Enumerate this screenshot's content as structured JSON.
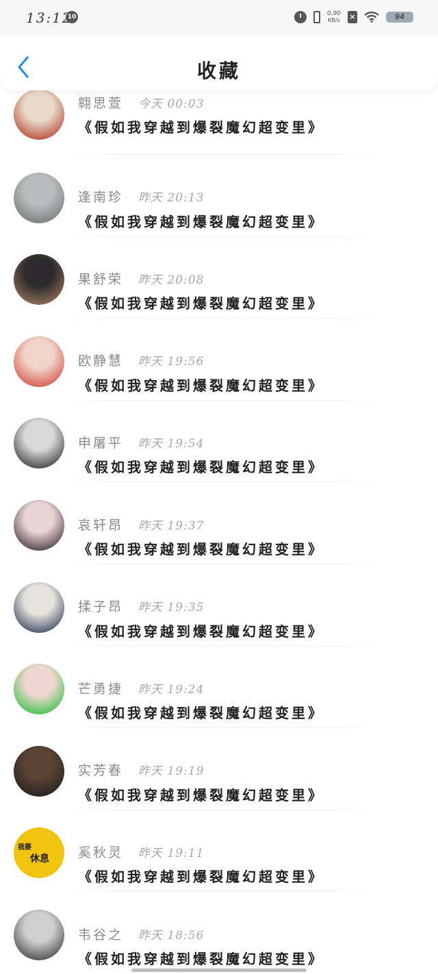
{
  "status_bar": {
    "time": "13:12",
    "notification_count": "10",
    "net_speed_value": "0.90",
    "net_speed_unit": "KB/s",
    "battery": "94"
  },
  "header": {
    "title": "收藏",
    "back_icon": "chevron-left-icon",
    "accent": "#2b8de6"
  },
  "favorites": [
    {
      "name": "翱思萱",
      "time": "今天 00:03",
      "title": "《假如我穿越到爆裂魔幻超变里》",
      "avatar_colors": [
        "#e8d9c8",
        "#b23b2a"
      ]
    },
    {
      "name": "逢南珍",
      "time": "昨天 20:13",
      "title": "《假如我穿越到爆裂魔幻超变里》",
      "avatar_colors": [
        "#b9bdbd",
        "#6f7676"
      ]
    },
    {
      "name": "果舒荣",
      "time": "昨天 20:08",
      "title": "《假如我穿越到爆裂魔幻超变里》",
      "avatar_colors": [
        "#2c2a2c",
        "#a27a5f"
      ]
    },
    {
      "name": "欧静慧",
      "time": "昨天 19:56",
      "title": "《假如我穿越到爆裂魔幻超变里》",
      "avatar_colors": [
        "#f2d3c9",
        "#d14a3b"
      ]
    },
    {
      "name": "申屠平",
      "time": "昨天 19:54",
      "title": "《假如我穿越到爆裂魔幻超变里》",
      "avatar_colors": [
        "#d8d8d8",
        "#2e2e2e"
      ]
    },
    {
      "name": "哀轩昂",
      "time": "昨天 19:37",
      "title": "《假如我穿越到爆裂魔幻超变里》",
      "avatar_colors": [
        "#e8d4d4",
        "#3a2b30"
      ]
    },
    {
      "name": "揉子昂",
      "time": "昨天 19:35",
      "title": "《假如我穿越到爆裂魔幻超变里》",
      "avatar_colors": [
        "#e6e2dc",
        "#2e3a55"
      ]
    },
    {
      "name": "芒勇捷",
      "time": "昨天 19:24",
      "title": "《假如我穿越到爆裂魔幻超变里》",
      "avatar_colors": [
        "#f0d6d0",
        "#29c23c"
      ]
    },
    {
      "name": "实芳春",
      "time": "昨天 19:19",
      "title": "《假如我穿越到爆裂魔幻超变里》",
      "avatar_colors": [
        "#5b4334",
        "#1e1e1e"
      ]
    },
    {
      "name": "奚秋灵",
      "time": "昨天 19:11",
      "title": "《假如我穿越到爆裂魔幻超变里》",
      "avatar_colors": [
        "#f1c40f",
        "#f1c40f"
      ],
      "avatar_text": [
        "我要",
        "休息"
      ]
    },
    {
      "name": "韦谷之",
      "time": "昨天 18:56",
      "title": "《假如我穿越到爆裂魔幻超变里》",
      "avatar_colors": [
        "#cfcfcf",
        "#3b3b3b"
      ]
    }
  ]
}
